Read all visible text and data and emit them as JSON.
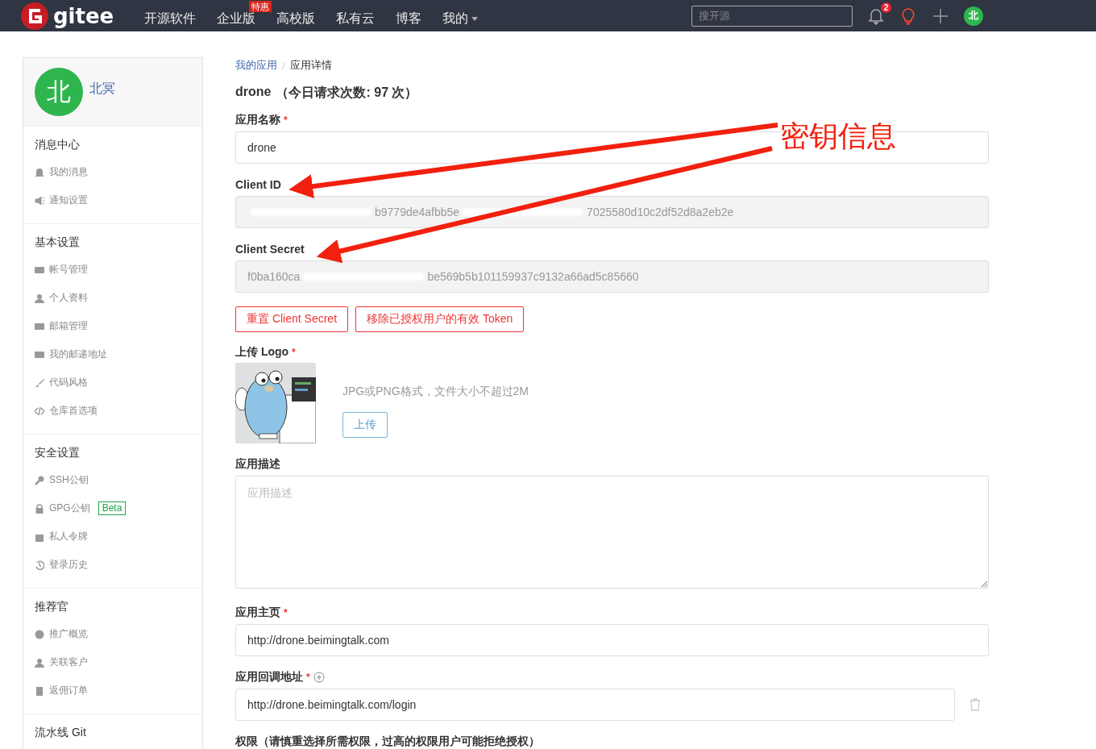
{
  "navbar": {
    "logo": "gitee",
    "links": [
      {
        "label": "开源软件"
      },
      {
        "label": "企业版",
        "badge": "特惠"
      },
      {
        "label": "高校版"
      },
      {
        "label": "私有云"
      },
      {
        "label": "博客"
      },
      {
        "label": "我的",
        "dropdown": true
      }
    ],
    "search": {
      "placeholder": "搜开源"
    },
    "notifications": "2",
    "avatar": "北"
  },
  "sidebar": {
    "user": {
      "avatar": "北",
      "name": "北冥"
    },
    "sections": [
      {
        "title": "消息中心",
        "items": [
          {
            "label": "我的消息"
          },
          {
            "label": "通知设置"
          }
        ]
      },
      {
        "title": "基本设置",
        "items": [
          {
            "label": "帐号管理"
          },
          {
            "label": "个人资料"
          },
          {
            "label": "邮箱管理"
          },
          {
            "label": "我的邮递地址"
          },
          {
            "label": "代码风格"
          },
          {
            "label": "仓库首选项"
          }
        ]
      },
      {
        "title": "安全设置",
        "items": [
          {
            "label": "SSH公钥"
          },
          {
            "label": "GPG公钥",
            "badge": "Beta"
          },
          {
            "label": "私人令牌"
          },
          {
            "label": "登录历史"
          }
        ]
      },
      {
        "title": "推荐官",
        "items": [
          {
            "label": "推广概览"
          },
          {
            "label": "关联客户"
          },
          {
            "label": "返佣订单"
          }
        ]
      },
      {
        "title": "流水线 Git"
      }
    ]
  },
  "breadcrumb": {
    "separator": "/",
    "items": [
      {
        "label": "我的应用",
        "link": true
      },
      {
        "label": "应用详情",
        "link": false
      }
    ]
  },
  "heading": {
    "name": "drone",
    "note": "（今日请求次数: 97 次）"
  },
  "fields": [
    {
      "kind": "input",
      "label": "应用名称",
      "required_mark": "*",
      "value": "drone"
    },
    {
      "kind": "readonly",
      "label": "Client ID",
      "leading_redaction": true,
      "segments": [
        "b9779de4afbb5e",
        "7025580d10c2df52d8a2eb2e"
      ]
    },
    {
      "kind": "readonly",
      "label": "Client Secret",
      "leading_redaction": false,
      "segments": [
        "f0ba160ca",
        "be569b5b101159937c9132a66ad5c85660"
      ]
    },
    {
      "kind": "buttons",
      "buttons": [
        "重置 Client Secret",
        "移除已授权用户的有效 Token"
      ]
    },
    {
      "kind": "logo",
      "label": "上传 Logo",
      "required_mark": "*",
      "hint": "JPG或PNG格式，文件大小不超过2M",
      "button": "上传"
    },
    {
      "kind": "textarea",
      "label": "应用描述",
      "placeholder": "应用描述"
    },
    {
      "kind": "input",
      "label": "应用主页",
      "required_mark": "*",
      "value": "http://drone.beimingtalk.com"
    },
    {
      "kind": "callback",
      "label": "应用回调地址",
      "required_mark": "*",
      "value": "http://drone.beimingtalk.com/login"
    },
    {
      "kind": "label",
      "label": "权限（请慎重选择所需权限，过高的权限用户可能拒绝授权）"
    }
  ],
  "annotation": {
    "text": "密钥信息"
  }
}
